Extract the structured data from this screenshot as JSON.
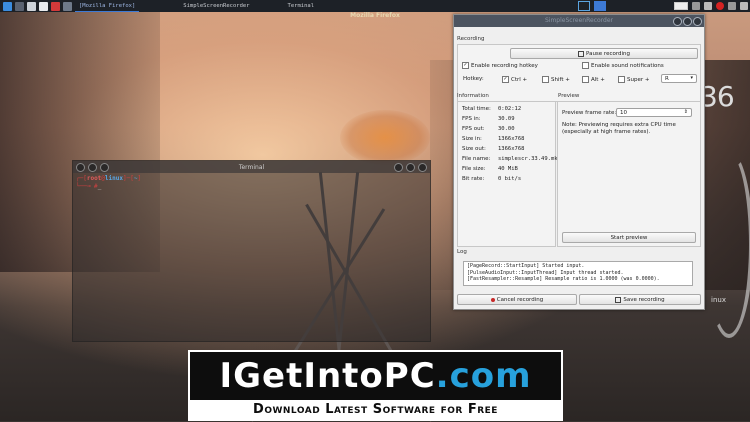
{
  "taskbar": {
    "tasks": [
      "[Mozilla Firefox]",
      "SimpleScreenRecorder",
      "Terminal"
    ],
    "colors": {
      "accent": "#3d7ad6",
      "bar": "#1d2127"
    }
  },
  "firefox": {
    "title": "Mozilla Firefox"
  },
  "terminal": {
    "title": "Terminal",
    "prompt_open": "┌─[",
    "user": "root",
    "at": "@",
    "host": "linux",
    "prompt_mid": "]─[",
    "path": "~",
    "prompt_close": "]",
    "prompt_line2": "└──╼ #",
    "cursor": "_"
  },
  "desktop": {
    "clock_fragment": "36",
    "os_label": "inux"
  },
  "recorder": {
    "title": "SimpleScreenRecorder",
    "recording_group": "Recording",
    "pause_button": "Pause recording",
    "enable_hotkey": "Enable recording hotkey",
    "enable_hotkey_checked": true,
    "enable_sound": "Enable sound notifications",
    "enable_sound_checked": false,
    "hotkey_label": "Hotkey:",
    "ctrl": "Ctrl +",
    "ctrl_checked": true,
    "shift": "Shift +",
    "alt": "Alt +",
    "super": "Super +",
    "key": "R",
    "information_group": "Information",
    "info": [
      {
        "label": "Total time:",
        "value": "0:02:12"
      },
      {
        "label": "FPS in:",
        "value": "30.09"
      },
      {
        "label": "FPS out:",
        "value": "30.00"
      },
      {
        "label": "Size in:",
        "value": "1366x768"
      },
      {
        "label": "Size out:",
        "value": "1366x768"
      },
      {
        "label": "File name:",
        "value": "simplescr.33.49.mkv"
      },
      {
        "label": "File size:",
        "value": "40 MiB"
      },
      {
        "label": "Bit rate:",
        "value": "0 bit/s"
      }
    ],
    "preview_group": "Preview",
    "preview_rate_label": "Preview frame rate:",
    "preview_rate_value": "10",
    "preview_note": "Note: Previewing requires extra CPU time (especially at high frame rates).",
    "start_preview": "Start preview",
    "log_group": "Log",
    "log_lines": [
      "[PageRecord::StartInput] Started input.",
      "[PulseAudioInput::InputThread] Input thread started.",
      "[FastResampler::Resample] Resample ratio is 1.0000 (was 0.0000)."
    ],
    "cancel_button": "Cancel recording",
    "save_button": "Save recording"
  },
  "banner": {
    "brand_main": "IGetIntoPC",
    "brand_suffix": ".com",
    "tagline": "Download Latest Software for Free",
    "colors": {
      "brand": "#ffffff",
      "suffix": "#27a1dc"
    }
  }
}
